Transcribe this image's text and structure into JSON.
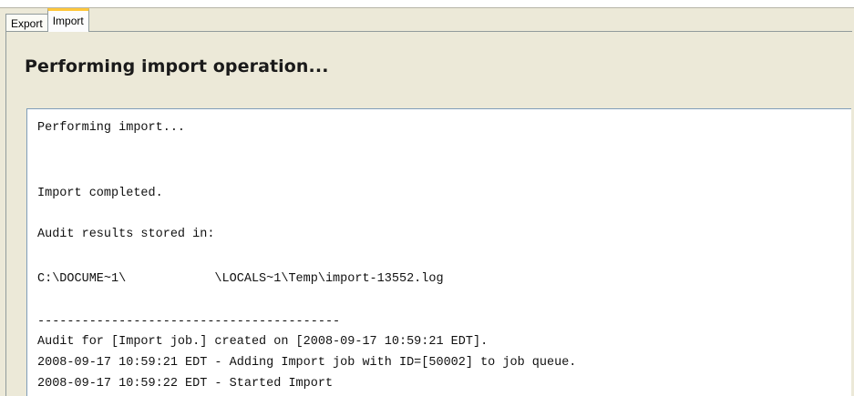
{
  "tabs": [
    {
      "label": "Export",
      "active": false
    },
    {
      "label": "Import",
      "active": true
    }
  ],
  "page_title": "Performing import operation...",
  "log": {
    "lines": [
      "Performing import...",
      "Import completed.",
      "Audit results stored in:",
      "C:\\DOCUME~1\\            \\LOCALS~1\\Temp\\import-13552.log",
      "-----------------------------------------",
      "Audit for [Import job.] created on [2008-09-17 10:59:21 EDT].",
      "2008-09-17 10:59:21 EDT - Adding Import job with ID=[50002] to job queue.",
      "2008-09-17 10:59:22 EDT - Started Import"
    ]
  },
  "colors": {
    "window_bg": "#ece9d8",
    "active_tab_highlight": "#ffc73c",
    "log_bg": "#ffffff",
    "border": "#919b9c"
  }
}
